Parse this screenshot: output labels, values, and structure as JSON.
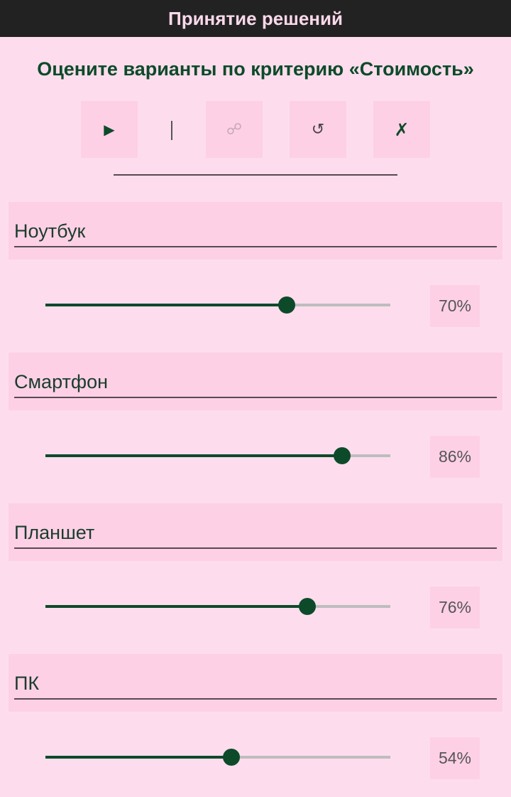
{
  "app": {
    "title": "Принятие решений"
  },
  "heading": "Оцените варианты по критерию «Стоимость»",
  "toolbar": {
    "play_icon": "▶",
    "separator": "|",
    "link_icon": "☍",
    "reset_icon": "↺",
    "close_icon": "✗"
  },
  "colors": {
    "accent": "#0d4a2a",
    "background": "#fddded",
    "panel": "#fdd0e6",
    "titlebar": "#222222"
  },
  "options": [
    {
      "label": "Ноутбук",
      "value": 70,
      "value_text": "70%"
    },
    {
      "label": "Смартфон",
      "value": 86,
      "value_text": "86%"
    },
    {
      "label": "Планшет",
      "value": 76,
      "value_text": "76%"
    },
    {
      "label": "ПК",
      "value": 54,
      "value_text": "54%"
    }
  ]
}
